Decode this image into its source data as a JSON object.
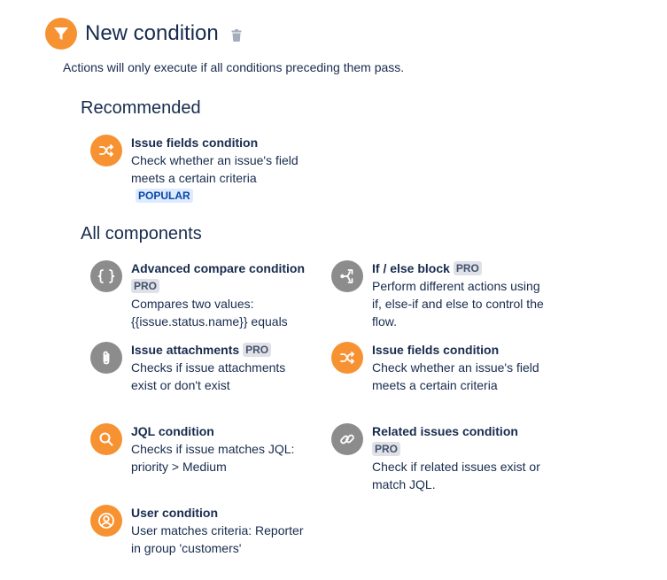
{
  "header": {
    "title": "New condition",
    "subtitle": "Actions will only execute if all conditions preceding them pass."
  },
  "sections": {
    "recommended": "Recommended",
    "all": "All components"
  },
  "badges": {
    "popular": "POPULAR",
    "pro": "PRO"
  },
  "recommended": [
    {
      "name": "Issue fields condition",
      "description": "Check whether an issue's field meets a certain criteria",
      "icon": "shuffle-icon",
      "color": "#f79232",
      "badge": "POPULAR"
    }
  ],
  "components": [
    {
      "name": "Advanced compare condition",
      "badge": "PRO",
      "description": "Compares two values: {{issue.status.name}} equals",
      "icon": "braces-icon",
      "color": "#8c8c8c"
    },
    {
      "name": "If / else block",
      "badge": "PRO",
      "description": "Perform different actions using if, else-if and else to control the flow.",
      "icon": "branch-icon",
      "color": "#8c8c8c"
    },
    {
      "name": "Issue attachments",
      "badge": "PRO",
      "description": "Checks if issue attachments exist or don't exist",
      "icon": "paperclip-icon",
      "color": "#8c8c8c"
    },
    {
      "name": "Issue fields condition",
      "description": "Check whether an issue's field meets a certain criteria",
      "icon": "shuffle-icon",
      "color": "#f79232"
    },
    {
      "name": "JQL condition",
      "description": "Checks if issue matches JQL: priority > Medium",
      "icon": "search-icon",
      "color": "#f79232"
    },
    {
      "name": "Related issues condition",
      "badge": "PRO",
      "description": "Check if related issues exist or match JQL.",
      "icon": "link-icon",
      "color": "#8c8c8c"
    },
    {
      "name": "User condition",
      "description": "User matches criteria: Reporter in group 'customers'",
      "icon": "user-icon",
      "color": "#f79232"
    }
  ]
}
